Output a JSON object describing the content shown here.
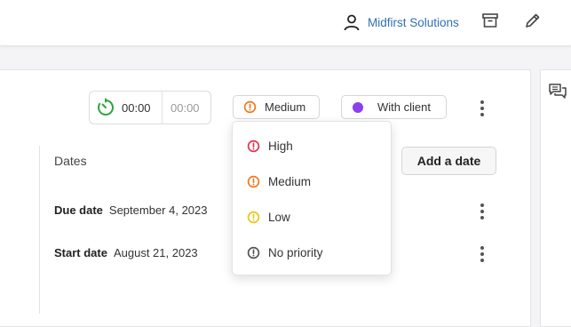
{
  "header": {
    "org_name": "Midfirst Solutions",
    "icons": [
      "user-icon",
      "archive-icon",
      "pencil-icon"
    ]
  },
  "timer": {
    "elapsed": "00:00",
    "estimate": "00:00"
  },
  "priority": {
    "selected": "Medium"
  },
  "status": {
    "label": "With client",
    "color": "#8b3ff0"
  },
  "dates": {
    "title": "Dates",
    "add_button": "Add a date",
    "rows": [
      {
        "label": "Due date",
        "value": "September 4, 2023"
      },
      {
        "label": "Start date",
        "value": "August 21, 2023"
      }
    ]
  },
  "priority_menu": {
    "items": [
      {
        "label": "High",
        "color": "#e0334f"
      },
      {
        "label": "Medium",
        "color": "#ee7a1f"
      },
      {
        "label": "Low",
        "color": "#eac51a"
      },
      {
        "label": "No priority",
        "color": "#555555"
      }
    ]
  },
  "colors": {
    "link": "#2f6fb5",
    "timer_green": "#2aa63f"
  }
}
